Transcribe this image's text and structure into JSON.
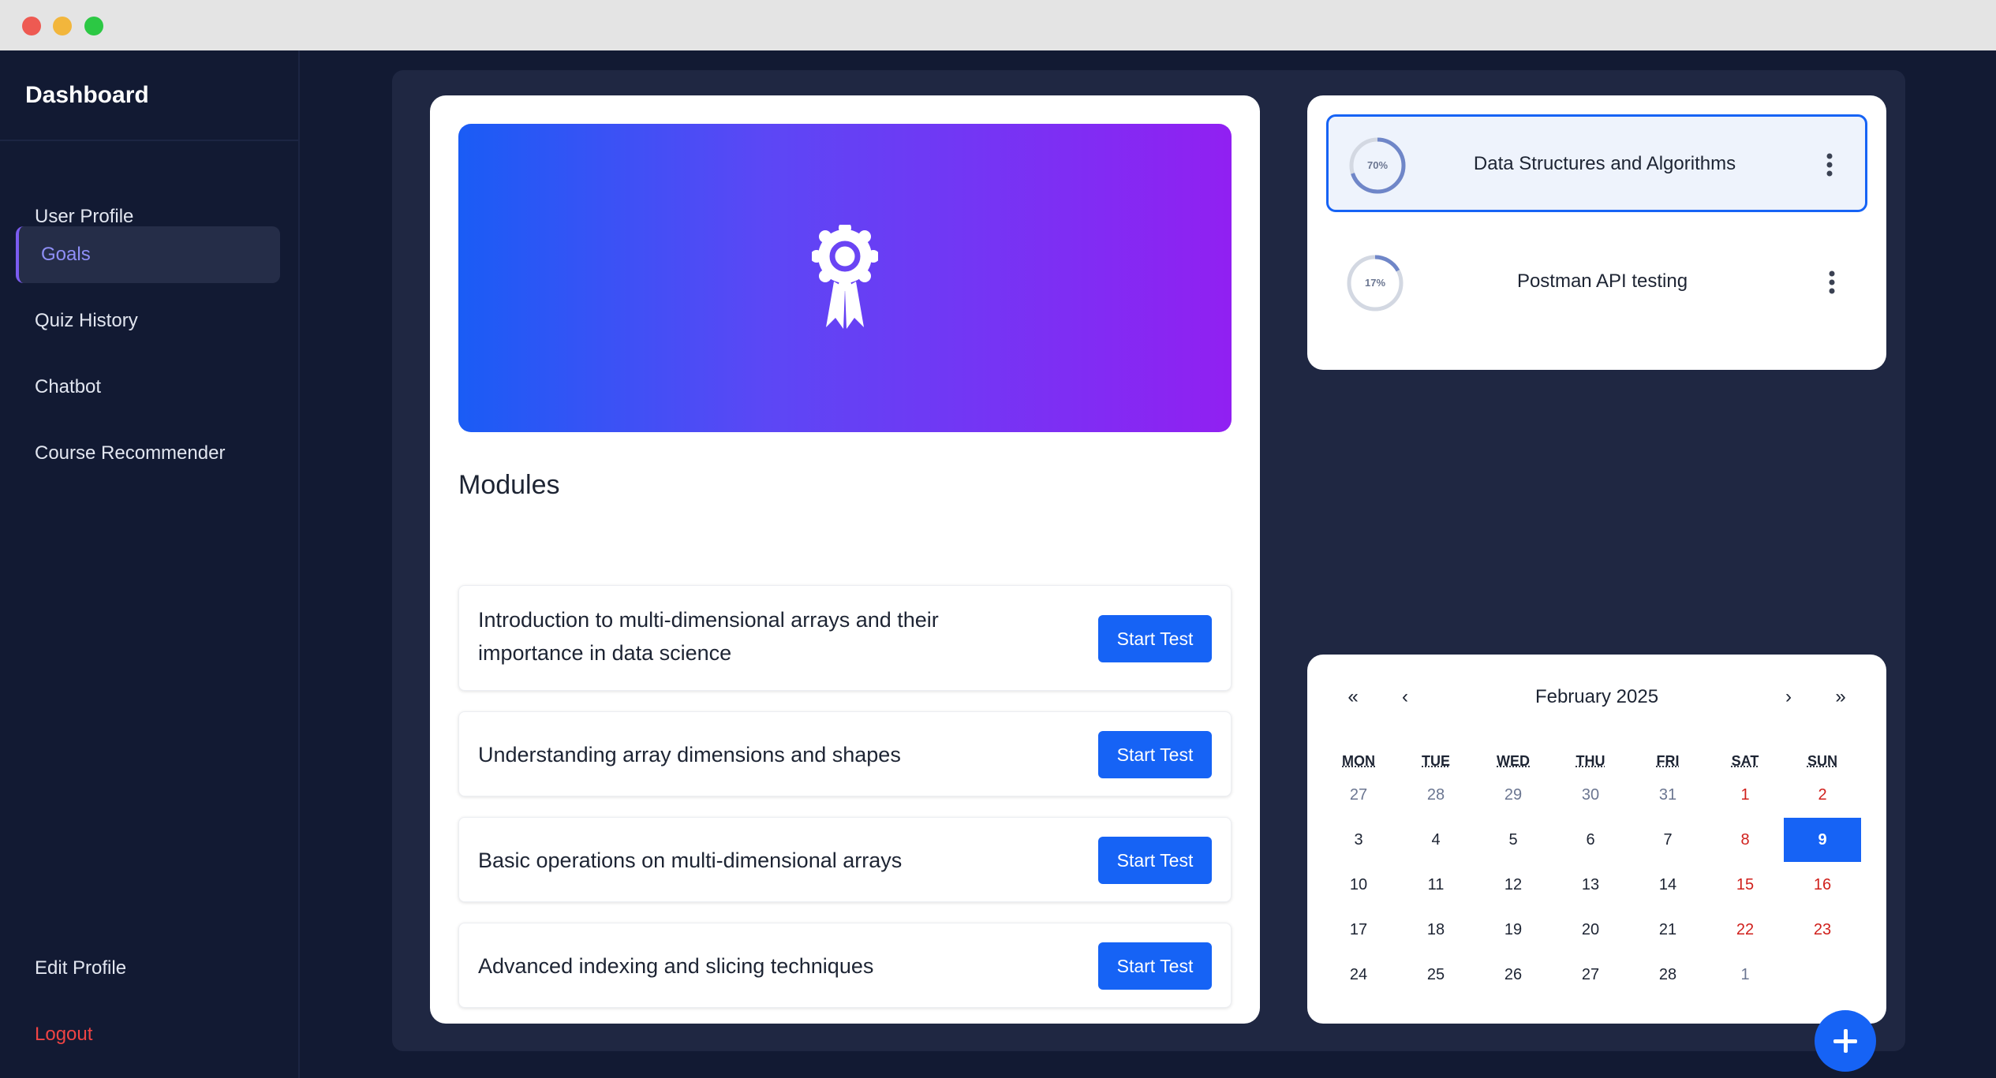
{
  "sidebar": {
    "brand": "Dashboard",
    "items": [
      {
        "label": "User Profile"
      },
      {
        "label": "Goals"
      },
      {
        "label": "Quiz History"
      },
      {
        "label": "Chatbot"
      },
      {
        "label": "Course Recommender"
      }
    ],
    "edit_profile": "Edit Profile",
    "logout": "Logout"
  },
  "modules": {
    "title": "Modules",
    "button_label": "Start Test",
    "items": [
      {
        "text": "Introduction to multi-dimensional arrays and their importance in data science"
      },
      {
        "text": "Understanding array dimensions and shapes"
      },
      {
        "text": "Basic operations on multi-dimensional arrays"
      },
      {
        "text": "Advanced indexing and slicing techniques"
      }
    ]
  },
  "goals": [
    {
      "title": "Data Structures and Algorithms",
      "progress_label": "70%",
      "progress": 0.7,
      "selected": true
    },
    {
      "title": "Postman API testing",
      "progress_label": "17%",
      "progress": 0.17,
      "selected": false
    }
  ],
  "calendar": {
    "month": "February 2025",
    "nav": {
      "prev_year": "«",
      "prev": "‹",
      "next": "›",
      "next_year": "»"
    },
    "weekdays": [
      "MON",
      "TUE",
      "WED",
      "THU",
      "FRI",
      "SAT",
      "SUN"
    ],
    "weeks": [
      [
        "27",
        "28",
        "29",
        "30",
        "31",
        "1",
        "2"
      ],
      [
        "3",
        "4",
        "5",
        "6",
        "7",
        "8",
        "9"
      ],
      [
        "10",
        "11",
        "12",
        "13",
        "14",
        "15",
        "16"
      ],
      [
        "17",
        "18",
        "19",
        "20",
        "21",
        "22",
        "23"
      ],
      [
        "24",
        "25",
        "26",
        "27",
        "28",
        "1",
        ""
      ]
    ],
    "today": "9"
  },
  "colors": {
    "accent": "#1663f5",
    "sidebar_bg": "#121a33",
    "active_nav": "#8f8ff7",
    "weekend": "#d0201c",
    "logout": "#f04444"
  }
}
